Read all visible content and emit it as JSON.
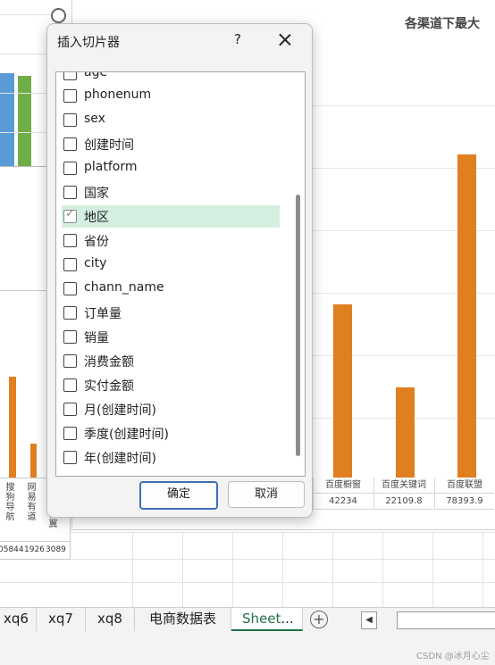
{
  "dialog": {
    "title": "插入切片器",
    "help_label": "?",
    "fields": [
      {
        "label": "age",
        "checked": false
      },
      {
        "label": "phonenum",
        "checked": false
      },
      {
        "label": "sex",
        "checked": false
      },
      {
        "label": "创建时间",
        "checked": false
      },
      {
        "label": "platform",
        "checked": false
      },
      {
        "label": "国家",
        "checked": false
      },
      {
        "label": "地区",
        "checked": true
      },
      {
        "label": "省份",
        "checked": false
      },
      {
        "label": "city",
        "checked": false
      },
      {
        "label": "chann_name",
        "checked": false
      },
      {
        "label": "订单量",
        "checked": false
      },
      {
        "label": "销量",
        "checked": false
      },
      {
        "label": "消费金额",
        "checked": false
      },
      {
        "label": "实付金额",
        "checked": false
      },
      {
        "label": "月(创建时间)",
        "checked": false
      },
      {
        "label": "季度(创建时间)",
        "checked": false
      },
      {
        "label": "年(创建时间)",
        "checked": false
      }
    ],
    "ok_label": "确定",
    "cancel_label": "取消"
  },
  "right_chart": {
    "title": "各渠道下最大",
    "categories": [
      "百度橱窗",
      "百度关键词",
      "百度联盟"
    ],
    "values": [
      "42234",
      "22109.8",
      "78393.9"
    ],
    "bar_color": "#e07f1f"
  },
  "left_chart": {
    "labels": [
      "搜狗导航",
      "网易有道",
      "快翼"
    ],
    "values": [
      "5844",
      "1926",
      "3089"
    ],
    "first_value_prefix": "0"
  },
  "tabs": {
    "items": [
      "xq6",
      "xq7",
      "xq8",
      "电商数据表",
      "Sheet"
    ],
    "active_index": 4,
    "active_overflow": "..."
  },
  "watermark": "CSDN @冰月心尘"
}
